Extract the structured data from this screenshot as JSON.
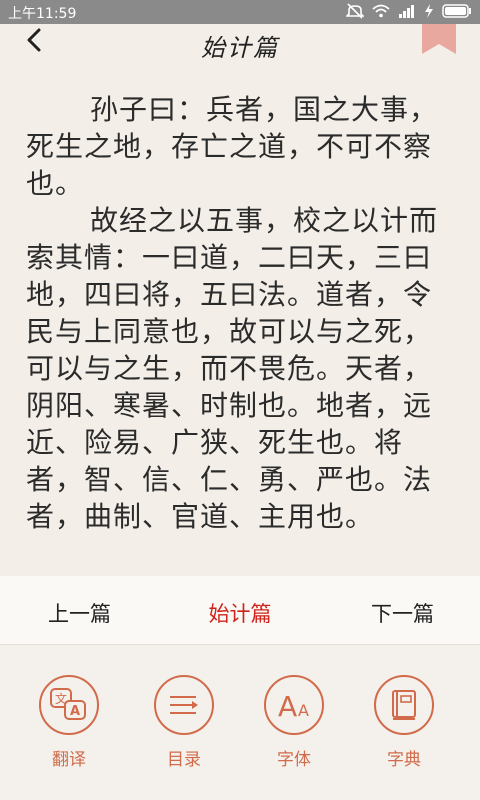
{
  "status_bar": {
    "time": "上午11:59"
  },
  "header": {
    "title": "始计篇"
  },
  "content": {
    "paragraphs": [
      "孙子曰：兵者，国之大事，死生之地，存亡之道，不可不察也。",
      "故经之以五事，校之以计而索其情：一曰道，二曰天，三曰地，四曰将，五曰法。道者，令民与上同意也，故可以与之死，可以与之生，而不畏危。天者，阴阳、寒暑、时制也。地者，远近、险易、广狭、死生也。将者，智、信、仁、勇、严也。法者，曲制、官道、主用也。"
    ]
  },
  "chapter_nav": {
    "prev": "上一篇",
    "current": "始计篇",
    "next": "下一篇"
  },
  "toolbar": {
    "translate": "翻译",
    "catalog": "目录",
    "font": "字体",
    "dictionary": "字典"
  },
  "colors": {
    "accent": "#d16b4b",
    "current_chapter": "#d0231b",
    "background": "#f3efe8"
  }
}
